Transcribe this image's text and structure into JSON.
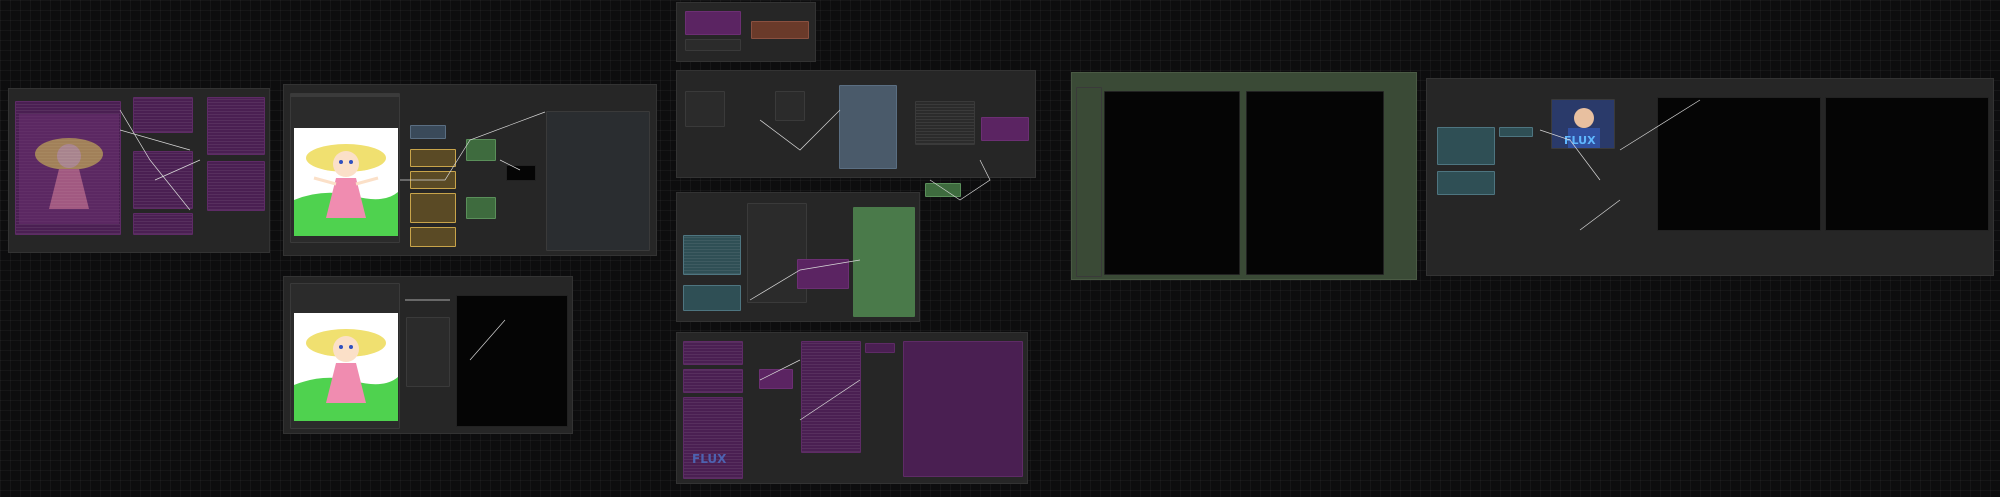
{
  "app": {
    "canvas_label": "workflow-canvas"
  },
  "flux_label": "FLUX",
  "colors": {
    "purple": "#4a1f52",
    "green": "#335533",
    "olive_panel": "#3a4a36",
    "background": "#0d0d0e"
  }
}
